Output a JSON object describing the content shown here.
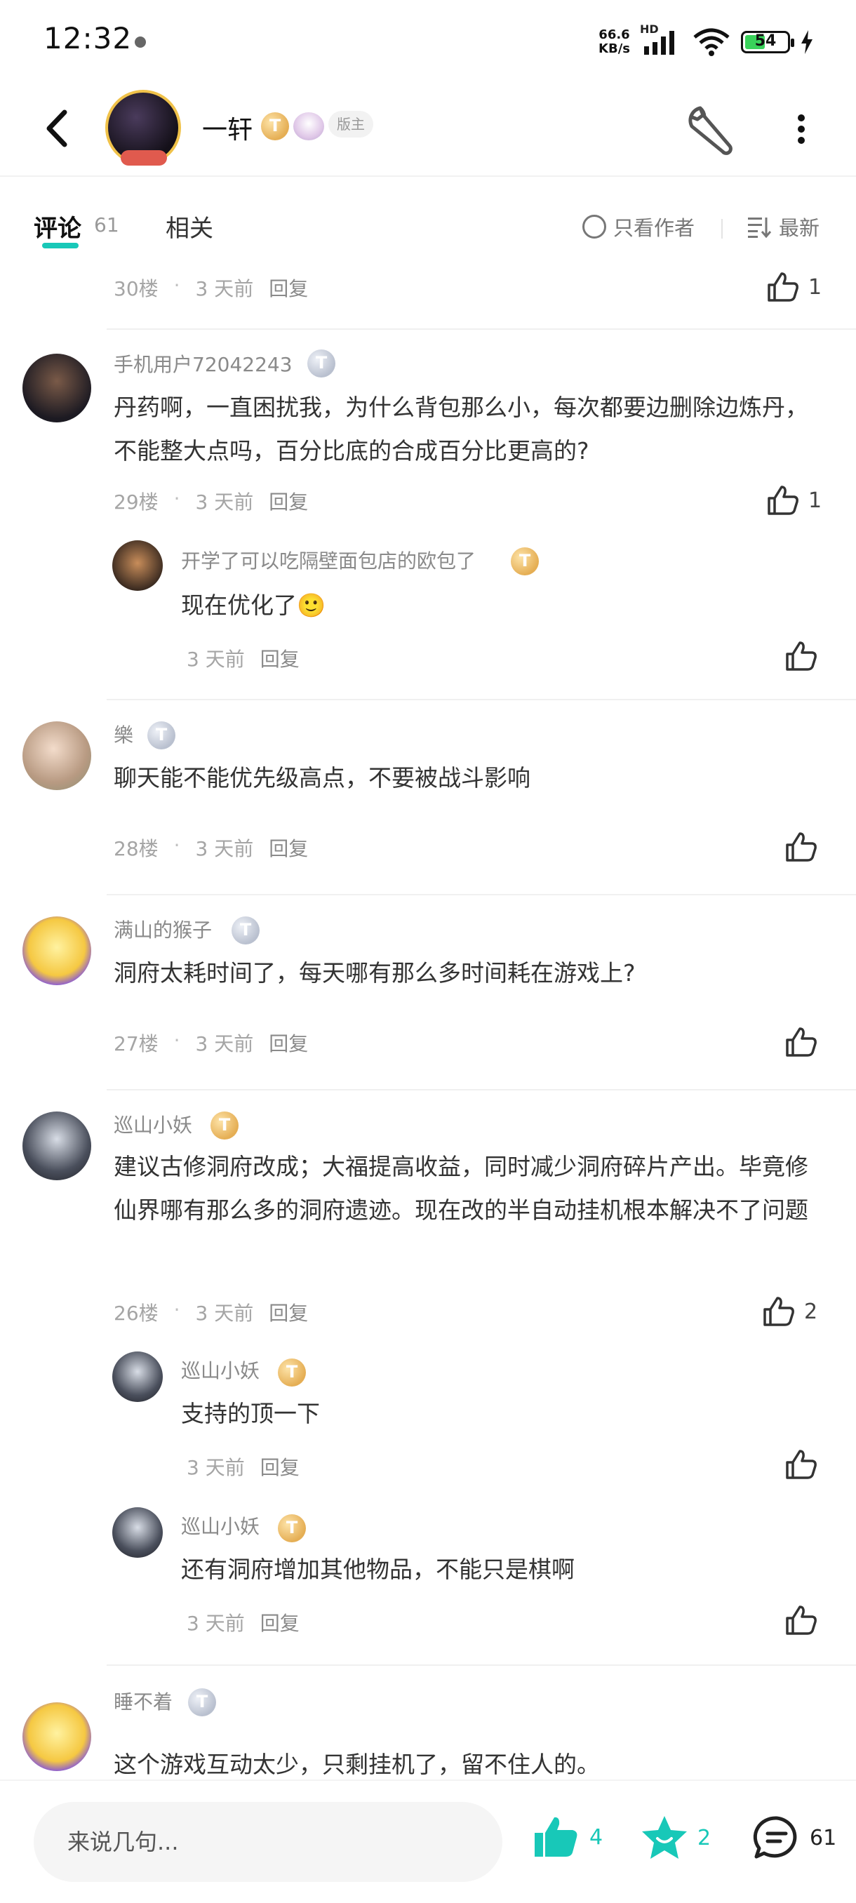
{
  "status_bar": {
    "time": "12:32",
    "speed_value": "66.6",
    "speed_unit": "KB/s",
    "network": "HD",
    "battery": "54"
  },
  "header": {
    "name": "一轩",
    "level_letter": "T",
    "mod_tag": "版主"
  },
  "tabs": {
    "comment_label": "评论",
    "comment_count": "61",
    "related_label": "相关",
    "only_author": "只看作者",
    "sort": "最新"
  },
  "comments": [
    {
      "floor": "30楼",
      "time": "3 天前",
      "reply": "回复",
      "likes": "1"
    },
    {
      "user": "手机用户72042243",
      "level": "T",
      "text": "丹药啊，一直困扰我，为什么背包那么小，每次都要边删除边炼丹，不能整大点吗，百分比底的合成百分比更高的?",
      "floor": "29楼",
      "time": "3 天前",
      "reply": "回复",
      "likes": "1",
      "sub": {
        "user": "开学了可以吃隔壁面包店的欧包了",
        "level": "T",
        "text": "现在优化了🙂",
        "time": "3 天前",
        "reply": "回复"
      }
    },
    {
      "user": "樂",
      "level": "T",
      "text": "聊天能不能优先级高点，不要被战斗影响",
      "floor": "28楼",
      "time": "3 天前",
      "reply": "回复"
    },
    {
      "user": "满山的猴子",
      "level": "T",
      "text": "洞府太耗时间了，每天哪有那么多时间耗在游戏上?",
      "floor": "27楼",
      "time": "3 天前",
      "reply": "回复"
    },
    {
      "user": "巡山小妖",
      "level": "T",
      "text": "建议古修洞府改成；大福提高收益，同时减少洞府碎片产出。毕竟修仙界哪有那么多的洞府遗迹。现在改的半自动挂机根本解决不了问题",
      "floor": "26楼",
      "time": "3 天前",
      "reply": "回复",
      "likes": "2",
      "subs": [
        {
          "user": "巡山小妖",
          "level": "T",
          "text": "支持的顶一下",
          "time": "3 天前",
          "reply": "回复"
        },
        {
          "user": "巡山小妖",
          "level": "T",
          "text": "还有洞府增加其他物品，不能只是棋啊",
          "time": "3 天前",
          "reply": "回复"
        }
      ]
    },
    {
      "user": "睡不着",
      "level": "T",
      "text": "这个游戏互动太少，只剩挂机了，留不住人的。"
    }
  ],
  "bottom_bar": {
    "input_placeholder": "来说几句...",
    "likes": "4",
    "stars": "2",
    "comments": "61"
  },
  "colors": {
    "accent": "#18c8b8",
    "gold_badge": "#e5ae54",
    "silver_badge": "#b9c0cf"
  }
}
